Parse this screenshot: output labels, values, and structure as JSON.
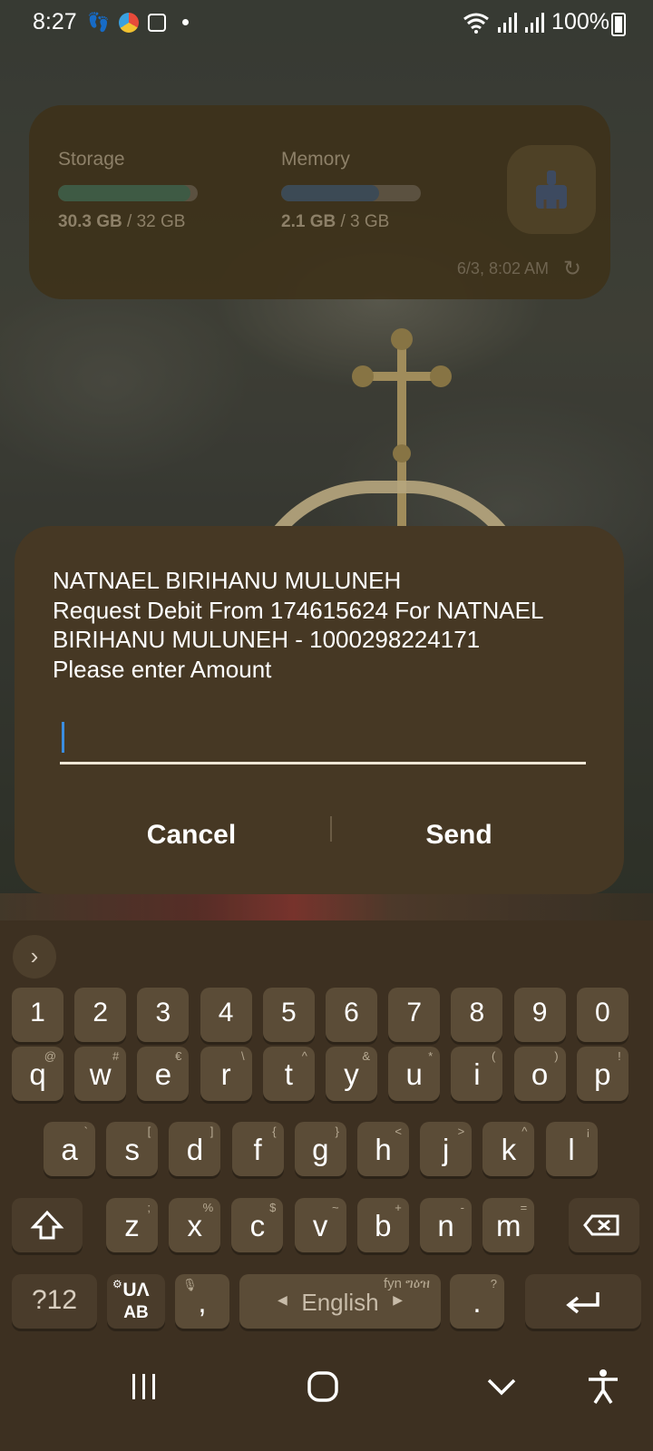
{
  "status_bar": {
    "time": "8:27",
    "battery": "100%"
  },
  "widget": {
    "storage_label": "Storage",
    "storage_used": "30.3 GB",
    "storage_total": "/ 32 GB",
    "storage_fraction": 0.95,
    "memory_label": "Memory",
    "memory_used": "2.1 GB",
    "memory_total": "/ 3 GB",
    "memory_fraction": 0.7,
    "updated": "6/3, 8:02 AM",
    "colors": {
      "storage": "#3e5a44",
      "memory": "#3c4a55"
    }
  },
  "dialog": {
    "message": "NATNAEL BIRIHANU MULUNEH\nRequest Debit From 174615624 For NATNAEL BIRIHANU MULUNEH - 1000298224171\nPlease enter Amount",
    "input_value": "",
    "cancel_label": "Cancel",
    "send_label": "Send"
  },
  "keyboard": {
    "numbers": [
      "1",
      "2",
      "3",
      "4",
      "5",
      "6",
      "7",
      "8",
      "9",
      "0"
    ],
    "row1": [
      {
        "k": "q",
        "s": "@"
      },
      {
        "k": "w",
        "s": "#"
      },
      {
        "k": "e",
        "s": "€"
      },
      {
        "k": "r",
        "s": "\\"
      },
      {
        "k": "t",
        "s": "^"
      },
      {
        "k": "y",
        "s": "&"
      },
      {
        "k": "u",
        "s": "*"
      },
      {
        "k": "i",
        "s": "("
      },
      {
        "k": "o",
        "s": ")"
      },
      {
        "k": "p",
        "s": "!"
      }
    ],
    "row2": [
      {
        "k": "a",
        "s": "`"
      },
      {
        "k": "s",
        "s": "["
      },
      {
        "k": "d",
        "s": "]"
      },
      {
        "k": "f",
        "s": "{"
      },
      {
        "k": "g",
        "s": "}"
      },
      {
        "k": "h",
        "s": "<"
      },
      {
        "k": "j",
        "s": ">"
      },
      {
        "k": "k",
        "s": "^"
      },
      {
        "k": "l",
        "s": "¡"
      }
    ],
    "row3": [
      {
        "k": "z",
        "s": ";"
      },
      {
        "k": "x",
        "s": "%"
      },
      {
        "k": "c",
        "s": "$"
      },
      {
        "k": "v",
        "s": "~"
      },
      {
        "k": "b",
        "s": "+"
      },
      {
        "k": "n",
        "s": "-"
      },
      {
        "k": "m",
        "s": "="
      }
    ],
    "symbols_label": "?12",
    "lang_switch_top": "UΛ",
    "lang_switch_bottom": "AB",
    "comma": ",",
    "space_label": "English",
    "space_sub": "fyn ግዕዝ",
    "period": ".",
    "period_sub": "?"
  }
}
